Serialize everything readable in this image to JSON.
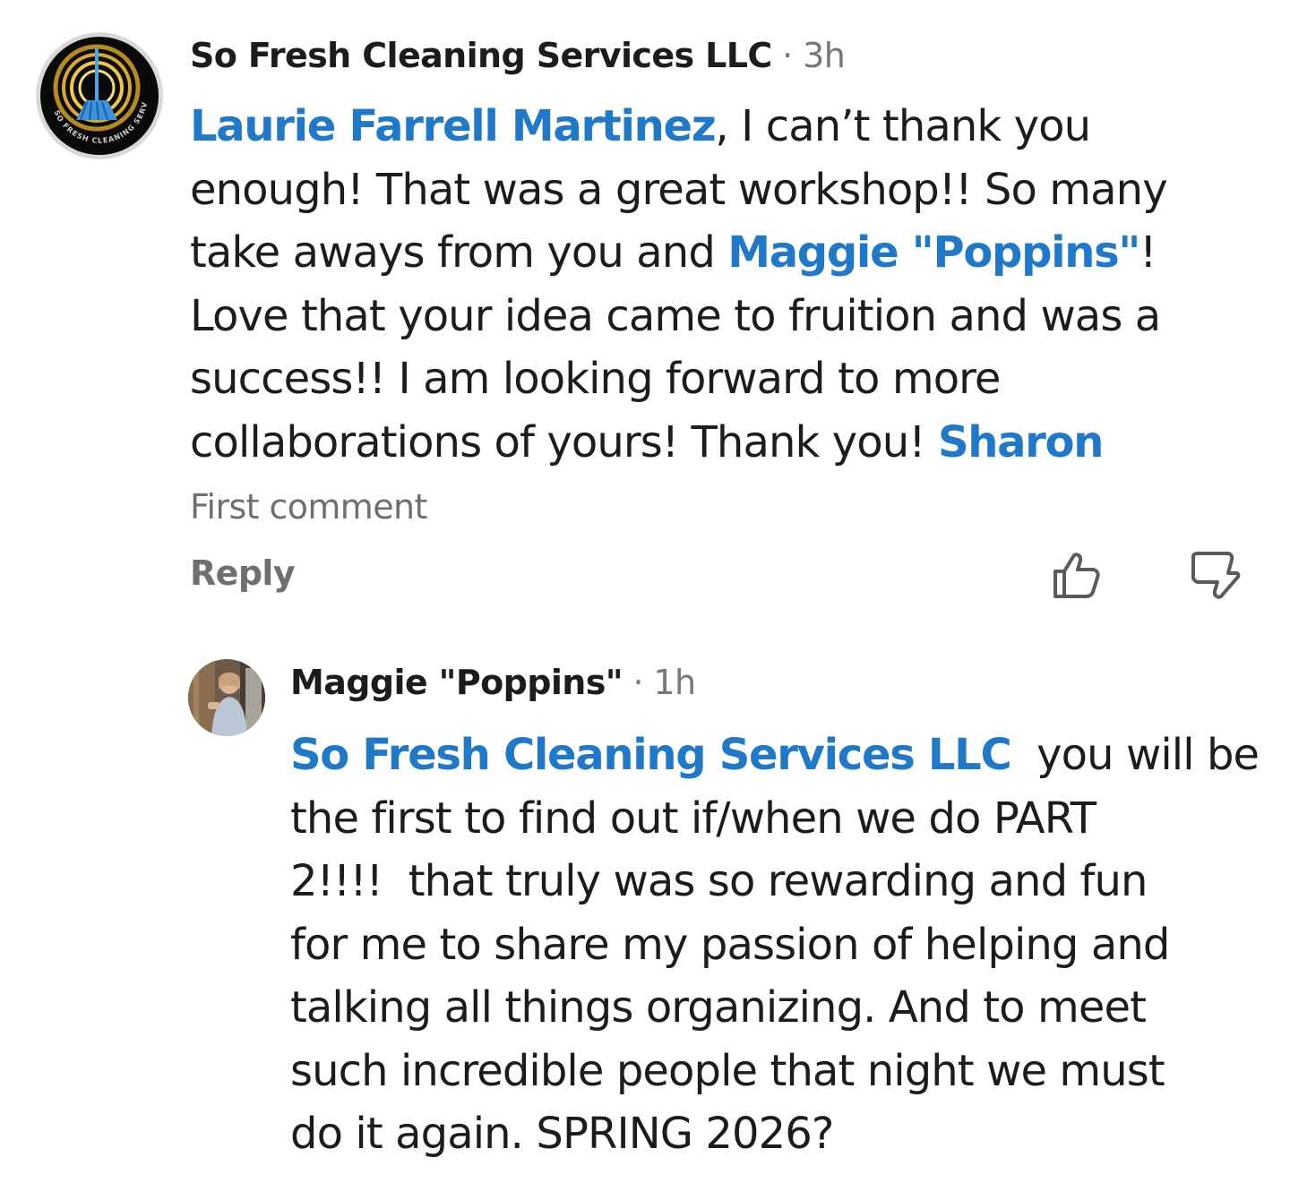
{
  "comment": {
    "author": "So Fresh Cleaning Services LLC",
    "separator": "·",
    "time": "3h",
    "avatar_icon": "broom-logo-icon",
    "avatar_logo_text": "SO FRESH CLEANING SERVICES LLC",
    "body": {
      "line1_mention": "Laurie Farrell Martinez",
      "line1_text": ", I can’t thank you",
      "line2": "enough! That was a great workshop!! So many",
      "line3_text": "take aways from you and ",
      "line3_mention": "Maggie \"Poppins\"",
      "line3_end": "!",
      "line4": "Love that your idea came to fruition and was a",
      "line5": "success!! I am looking forward to more",
      "line6_text": "collaborations of yours! Thank you! ",
      "line6_mention": "Sharon"
    },
    "badge": "First comment",
    "reply_label": "Reply",
    "like_icon": "thumbs-up-icon",
    "dislike_icon": "thumbs-down-icon"
  },
  "reply": {
    "author": "Maggie \"Poppins\"",
    "separator": "·",
    "time": "1h",
    "avatar_icon": "profile-photo",
    "body": {
      "line1_mention": "So Fresh Cleaning Services LLC",
      "line1_text": "  you will be",
      "line2": "the first to find out if/when we do PART",
      "line3": "2!!!!  that truly was so rewarding and fun",
      "line4": "for me to share my passion of helping and",
      "line5": "talking all things organizing. And to meet",
      "line6": "such incredible people that night we must",
      "line7": "do it again. SPRING 2026?"
    }
  },
  "colors": {
    "mention": "#1f78c8",
    "muted": "#6f6f6f",
    "text": "#1c1c1c"
  }
}
